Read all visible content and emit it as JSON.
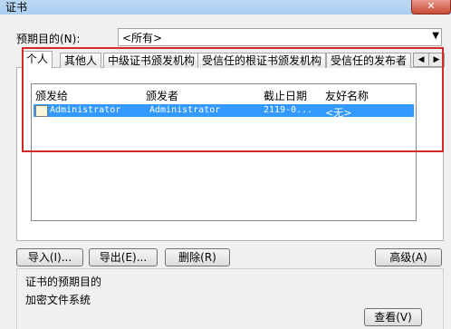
{
  "window": {
    "title": "证书",
    "close_glyph": "✕"
  },
  "purpose": {
    "label": "预期目的(N):",
    "value": "<所有>"
  },
  "tabs": [
    {
      "label": "个人"
    },
    {
      "label": "其他人"
    },
    {
      "label": "中级证书颁发机构"
    },
    {
      "label": "受信任的根证书颁发机构"
    },
    {
      "label": "受信任的发布者"
    }
  ],
  "list": {
    "columns": [
      "颁发给",
      "颁发者",
      "截止日期",
      "友好名称"
    ],
    "rows": [
      {
        "issued_to": "Administrator",
        "issued_by": "Administrator",
        "expires": "2119-0...",
        "friendly": "<无>"
      }
    ]
  },
  "buttons": {
    "import": "导入(I)...",
    "export": "导出(E)...",
    "remove": "删除(R)",
    "advanced": "高级(A)",
    "view": "查看(V)"
  },
  "purposes_section": {
    "title": "证书的预期目的",
    "value": "加密文件系统"
  }
}
